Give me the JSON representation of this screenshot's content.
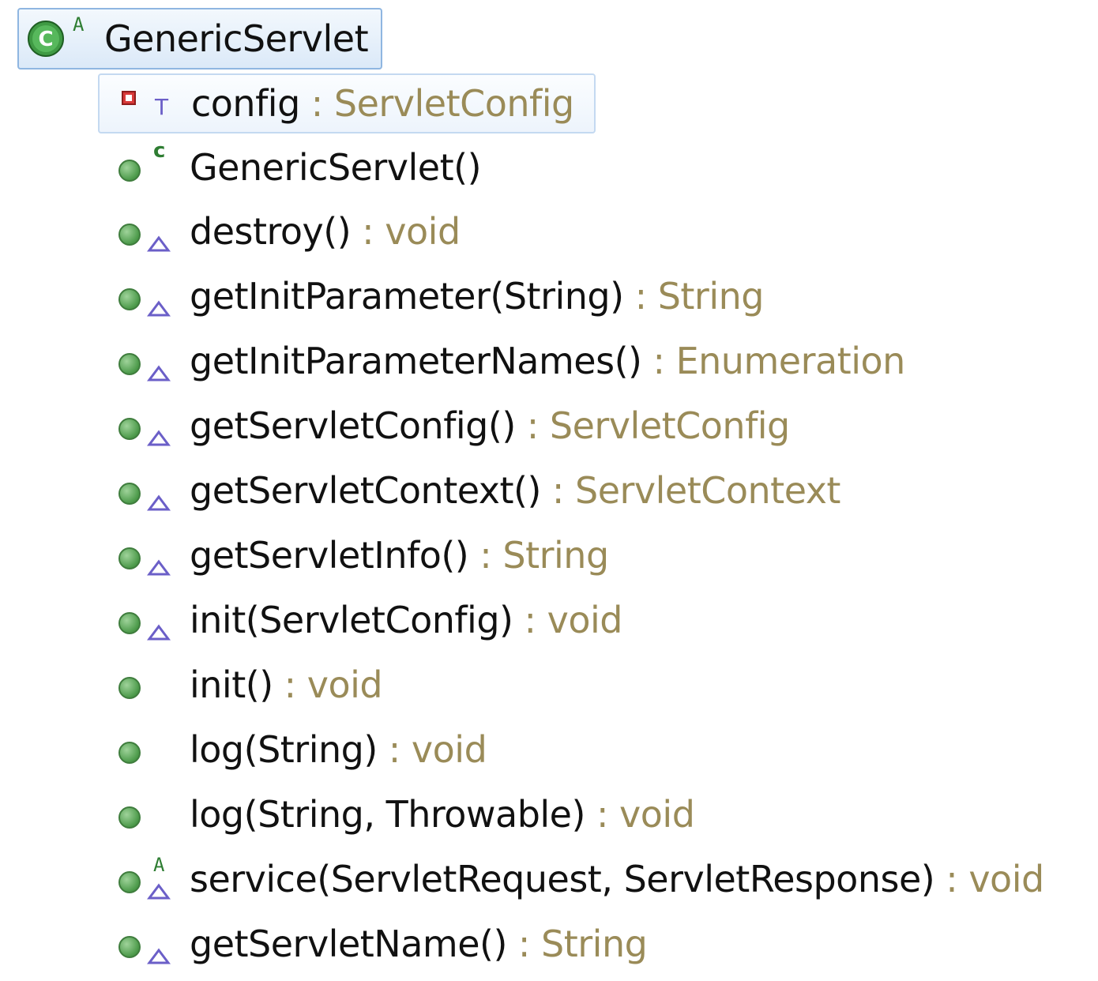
{
  "outline": {
    "class_node": {
      "name": "GenericServlet",
      "icon": "class-icon",
      "adornment": "A"
    },
    "members": [
      {
        "name": "config",
        "type": ": ServletConfig",
        "icon": "private-field-icon",
        "overlay": "transient-icon",
        "adornment": "T"
      },
      {
        "name": "GenericServlet()",
        "type": "",
        "icon": "public-method-icon",
        "overlay": "constructor-icon",
        "adornment": "c"
      },
      {
        "name": "destroy()",
        "type": ": void",
        "icon": "public-method-icon",
        "overlay": "implements-icon"
      },
      {
        "name": "getInitParameter(String)",
        "type": ": String",
        "icon": "public-method-icon",
        "overlay": "implements-icon"
      },
      {
        "name": "getInitParameterNames()",
        "type": ": Enumeration",
        "icon": "public-method-icon",
        "overlay": "implements-icon"
      },
      {
        "name": "getServletConfig()",
        "type": ": ServletConfig",
        "icon": "public-method-icon",
        "overlay": "implements-icon"
      },
      {
        "name": "getServletContext()",
        "type": ": ServletContext",
        "icon": "public-method-icon",
        "overlay": "implements-icon"
      },
      {
        "name": "getServletInfo()",
        "type": ": String",
        "icon": "public-method-icon",
        "overlay": "implements-icon"
      },
      {
        "name": "init(ServletConfig)",
        "type": ": void",
        "icon": "public-method-icon",
        "overlay": "implements-icon"
      },
      {
        "name": "init()",
        "type": ": void",
        "icon": "public-method-icon",
        "overlay": ""
      },
      {
        "name": "log(String)",
        "type": ": void",
        "icon": "public-method-icon",
        "overlay": ""
      },
      {
        "name": "log(String, Throwable)",
        "type": ": void",
        "icon": "public-method-icon",
        "overlay": ""
      },
      {
        "name": "service(ServletRequest, ServletResponse)",
        "type": ": void",
        "icon": "public-method-icon",
        "overlay": "abstract-implements-icon",
        "adornment": "A"
      },
      {
        "name": "getServletName()",
        "type": ": String",
        "icon": "public-method-icon",
        "overlay": "implements-icon"
      }
    ]
  },
  "colors": {
    "text": "#111111",
    "type_text": "#9a8b58",
    "selection_border": "#8fb6e1",
    "method_green": "#4c9a4a",
    "private_red": "#d83a3a",
    "overlay_purple": "#6b5fc8"
  }
}
